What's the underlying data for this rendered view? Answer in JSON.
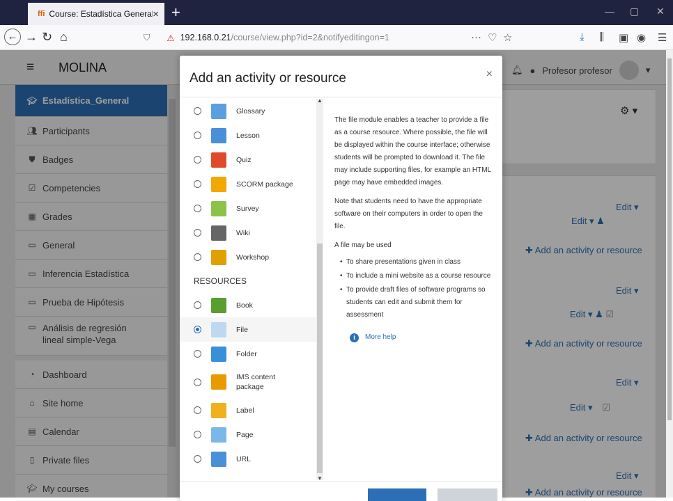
{
  "browser": {
    "tab_title": "Course: Estadística General",
    "tab_icon": "ffi",
    "close_glyph": "×",
    "newtab_glyph": "+",
    "url_host": "192.168.0.21",
    "url_path": "/course/view.php?id=2&notifyeditingon=1"
  },
  "header": {
    "site_name": "MOLINA",
    "user_name": "Profesor profesor"
  },
  "sidebar": {
    "items": [
      {
        "label": "Estadística_General",
        "icon": "graduation-cap-icon"
      },
      {
        "label": "Participants",
        "icon": "users-icon"
      },
      {
        "label": "Badges",
        "icon": "shield-icon"
      },
      {
        "label": "Competencies",
        "icon": "check-square-icon"
      },
      {
        "label": "Grades",
        "icon": "table-icon"
      },
      {
        "label": "General",
        "icon": "folder-icon"
      },
      {
        "label": "Inferencia Estadística",
        "icon": "folder-icon"
      },
      {
        "label": "Prueba de Hipótesis",
        "icon": "folder-icon"
      },
      {
        "label": "Análisis de regresión lineal simple-Vega",
        "icon": "folder-icon"
      },
      {
        "label": "Dashboard",
        "icon": "dashboard-icon"
      },
      {
        "label": "Site home",
        "icon": "home-icon"
      },
      {
        "label": "Calendar",
        "icon": "calendar-icon"
      },
      {
        "label": "Private files",
        "icon": "file-icon"
      },
      {
        "label": "My courses",
        "icon": "graduation-cap-icon"
      }
    ]
  },
  "course": {
    "edit_label": "Edit",
    "add_activity_label": "Add an activity or resource"
  },
  "modal": {
    "title": "Add an activity or resource",
    "close_glyph": "×",
    "activities": [
      {
        "label": "Glossary",
        "icon": "glossary-icon",
        "color": "#5aa0e0"
      },
      {
        "label": "Lesson",
        "icon": "lesson-icon",
        "color": "#4a90d9"
      },
      {
        "label": "Quiz",
        "icon": "quiz-icon",
        "color": "#e04a2a"
      },
      {
        "label": "SCORM package",
        "icon": "scorm-icon",
        "color": "#f2a800"
      },
      {
        "label": "Survey",
        "icon": "survey-icon",
        "color": "#8bc34a"
      },
      {
        "label": "Wiki",
        "icon": "wiki-icon",
        "color": "#666666"
      },
      {
        "label": "Workshop",
        "icon": "workshop-icon",
        "color": "#e0a000"
      }
    ],
    "resources_heading": "RESOURCES",
    "resources": [
      {
        "label": "Book",
        "icon": "book-icon",
        "color": "#5a9e2f",
        "selected": false
      },
      {
        "label": "File",
        "icon": "file-icon",
        "color": "#bcd9f0",
        "selected": true
      },
      {
        "label": "Folder",
        "icon": "folder-icon",
        "color": "#3a8fd9",
        "selected": false
      },
      {
        "label": "IMS content package",
        "icon": "ims-package-icon",
        "color": "#e89a00",
        "selected": false
      },
      {
        "label": "Label",
        "icon": "label-icon",
        "color": "#f0b020",
        "selected": false
      },
      {
        "label": "Page",
        "icon": "page-icon",
        "color": "#7ab8e8",
        "selected": false
      },
      {
        "label": "URL",
        "icon": "url-icon",
        "color": "#4a90d9",
        "selected": false
      }
    ],
    "description": [
      "The file module enables a teacher to provide a file as a course resource. Where possible, the file will be displayed within the course interface; otherwise students will be prompted to download it. The file may include supporting files, for example an HTML page may have embedded images.",
      "Note that students need to have the appropriate software on their computers in order to open the file.",
      "A file may be used"
    ],
    "uses": [
      "To share presentations given in class",
      "To include a mini website as a course resource",
      "To provide draft files of software programs so students can edit and submit them for assessment"
    ],
    "more_help": "More help"
  },
  "colors": {
    "primary": "#2d6fb6",
    "titlebar": "#202340"
  }
}
